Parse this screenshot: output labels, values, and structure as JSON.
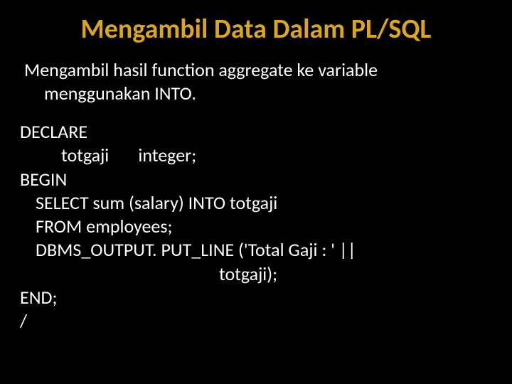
{
  "title": "Mengambil Data Dalam PL/SQL",
  "subtitle": {
    "line1": "Mengambil hasil function aggregate ke variable",
    "line2": "menggunakan INTO."
  },
  "code": {
    "l1": "DECLARE",
    "l2": "totgaji       integer;",
    "l3": "BEGIN",
    "l4": "SELECT sum (salary) INTO totgaji",
    "l5": "FROM employees;",
    "l6": "DBMS_OUTPUT. PUT_LINE ('Total Gaji : ' ||",
    "l7": "totgaji);",
    "l8": "END;",
    "l9": "/"
  }
}
